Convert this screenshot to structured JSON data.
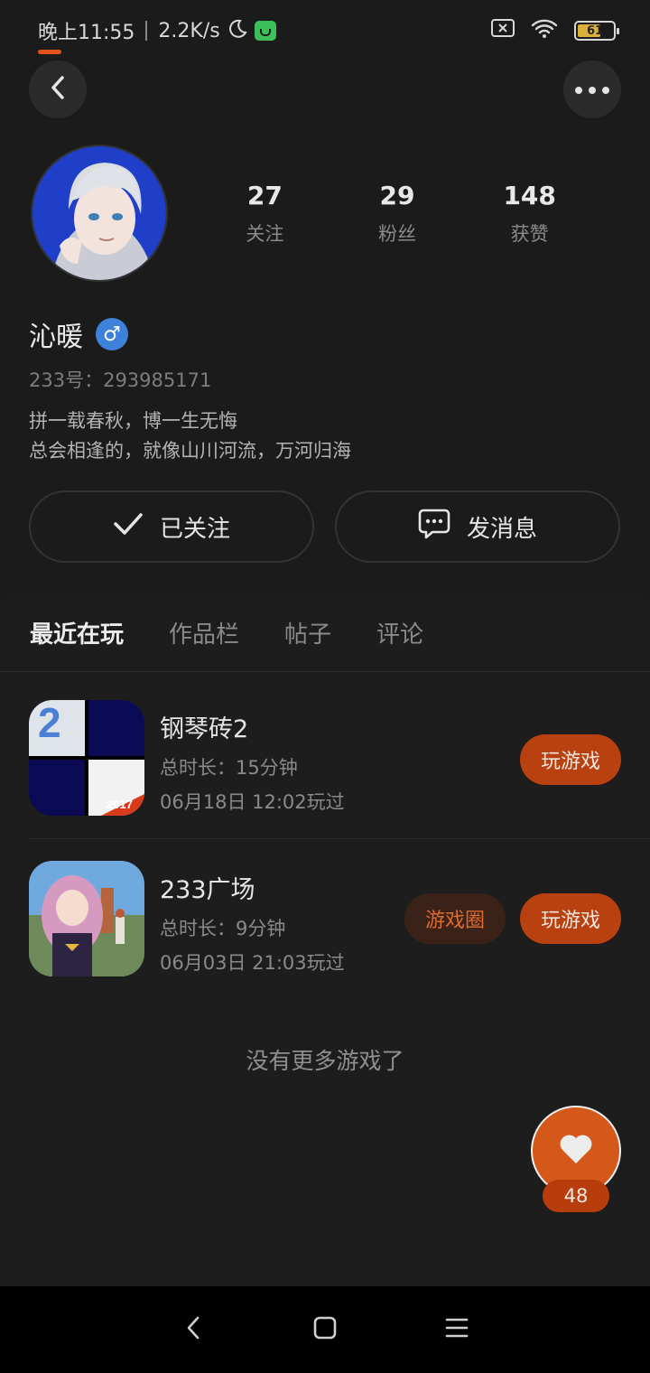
{
  "status_bar": {
    "time": "晚上11:55",
    "speed": "2.2K/s",
    "battery_level": "61"
  },
  "profile": {
    "stats": [
      {
        "value": "27",
        "label": "关注"
      },
      {
        "value": "29",
        "label": "粉丝"
      },
      {
        "value": "148",
        "label": "获赞"
      }
    ],
    "username": "沁暖",
    "gender_symbol": "♂",
    "uid": "233号：293985171",
    "bio_line1": "拼一载春秋，博一生无悔",
    "bio_line2": "总会相逢的，就像山川河流，万河归海"
  },
  "actions": {
    "follow_label": "已关注",
    "message_label": "发消息"
  },
  "tabs": [
    {
      "label": "最近在玩",
      "active": true
    },
    {
      "label": "作品栏",
      "active": false
    },
    {
      "label": "帖子",
      "active": false
    },
    {
      "label": "评论",
      "active": false
    }
  ],
  "games": [
    {
      "name": "钢琴砖2",
      "duration": "总时长：15分钟",
      "last_played": "06月18日 12:02玩过",
      "play_label": "玩游戏",
      "icon_text": "2",
      "icon_badge": "2017"
    },
    {
      "name": "233广场",
      "duration": "总时长：9分钟",
      "last_played": "06月03日 21:03玩过",
      "circle_label": "游戏圈",
      "play_label": "玩游戏"
    }
  ],
  "no_more_text": "没有更多游戏了",
  "like": {
    "count": "48"
  },
  "colors": {
    "accent": "#d4581a",
    "play_button": "#b9400f",
    "background": "#1b1b1b"
  }
}
